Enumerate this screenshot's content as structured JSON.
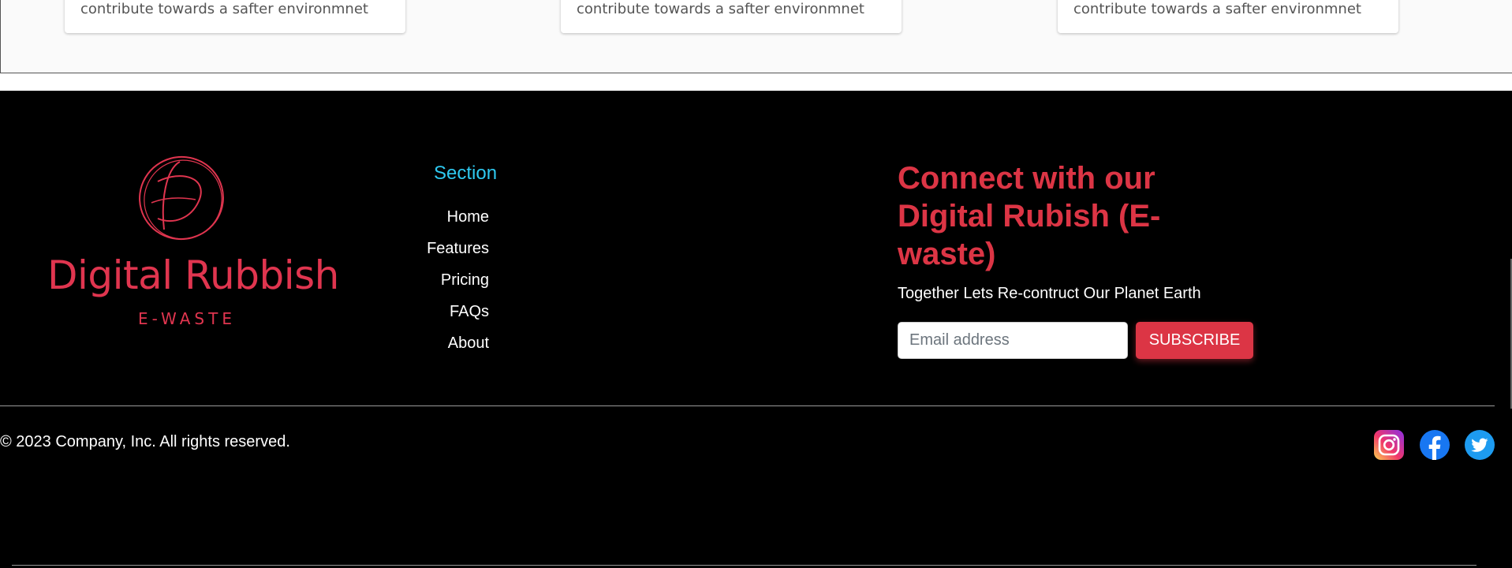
{
  "cards": [
    {
      "text": "contribute towards a safter environmnet"
    },
    {
      "text": "contribute towards a safter environmnet"
    },
    {
      "text": "contribute towards a safter environmnet"
    }
  ],
  "footer": {
    "logo": {
      "name": "Digital Rubbish",
      "tagline": "E-WASTE",
      "color": "#e0354f"
    },
    "section_title": "Section",
    "nav": [
      "Home",
      "Features",
      "Pricing",
      "FAQs",
      "About"
    ],
    "connect_title": "Connect with our Digital Rubish (E-waste)",
    "connect_subtitle": "Together Lets Re-contruct Our Planet Earth",
    "email_placeholder": "Email address",
    "subscribe_label": "SUBSCRIBE",
    "copyright": "© 2023 Company, Inc. All rights reserved.",
    "social_icons": [
      "instagram-icon",
      "facebook-icon",
      "twitter-icon"
    ]
  },
  "colors": {
    "accent": "#dc3545",
    "section_title": "#2ec9f0",
    "background": "#000000"
  }
}
